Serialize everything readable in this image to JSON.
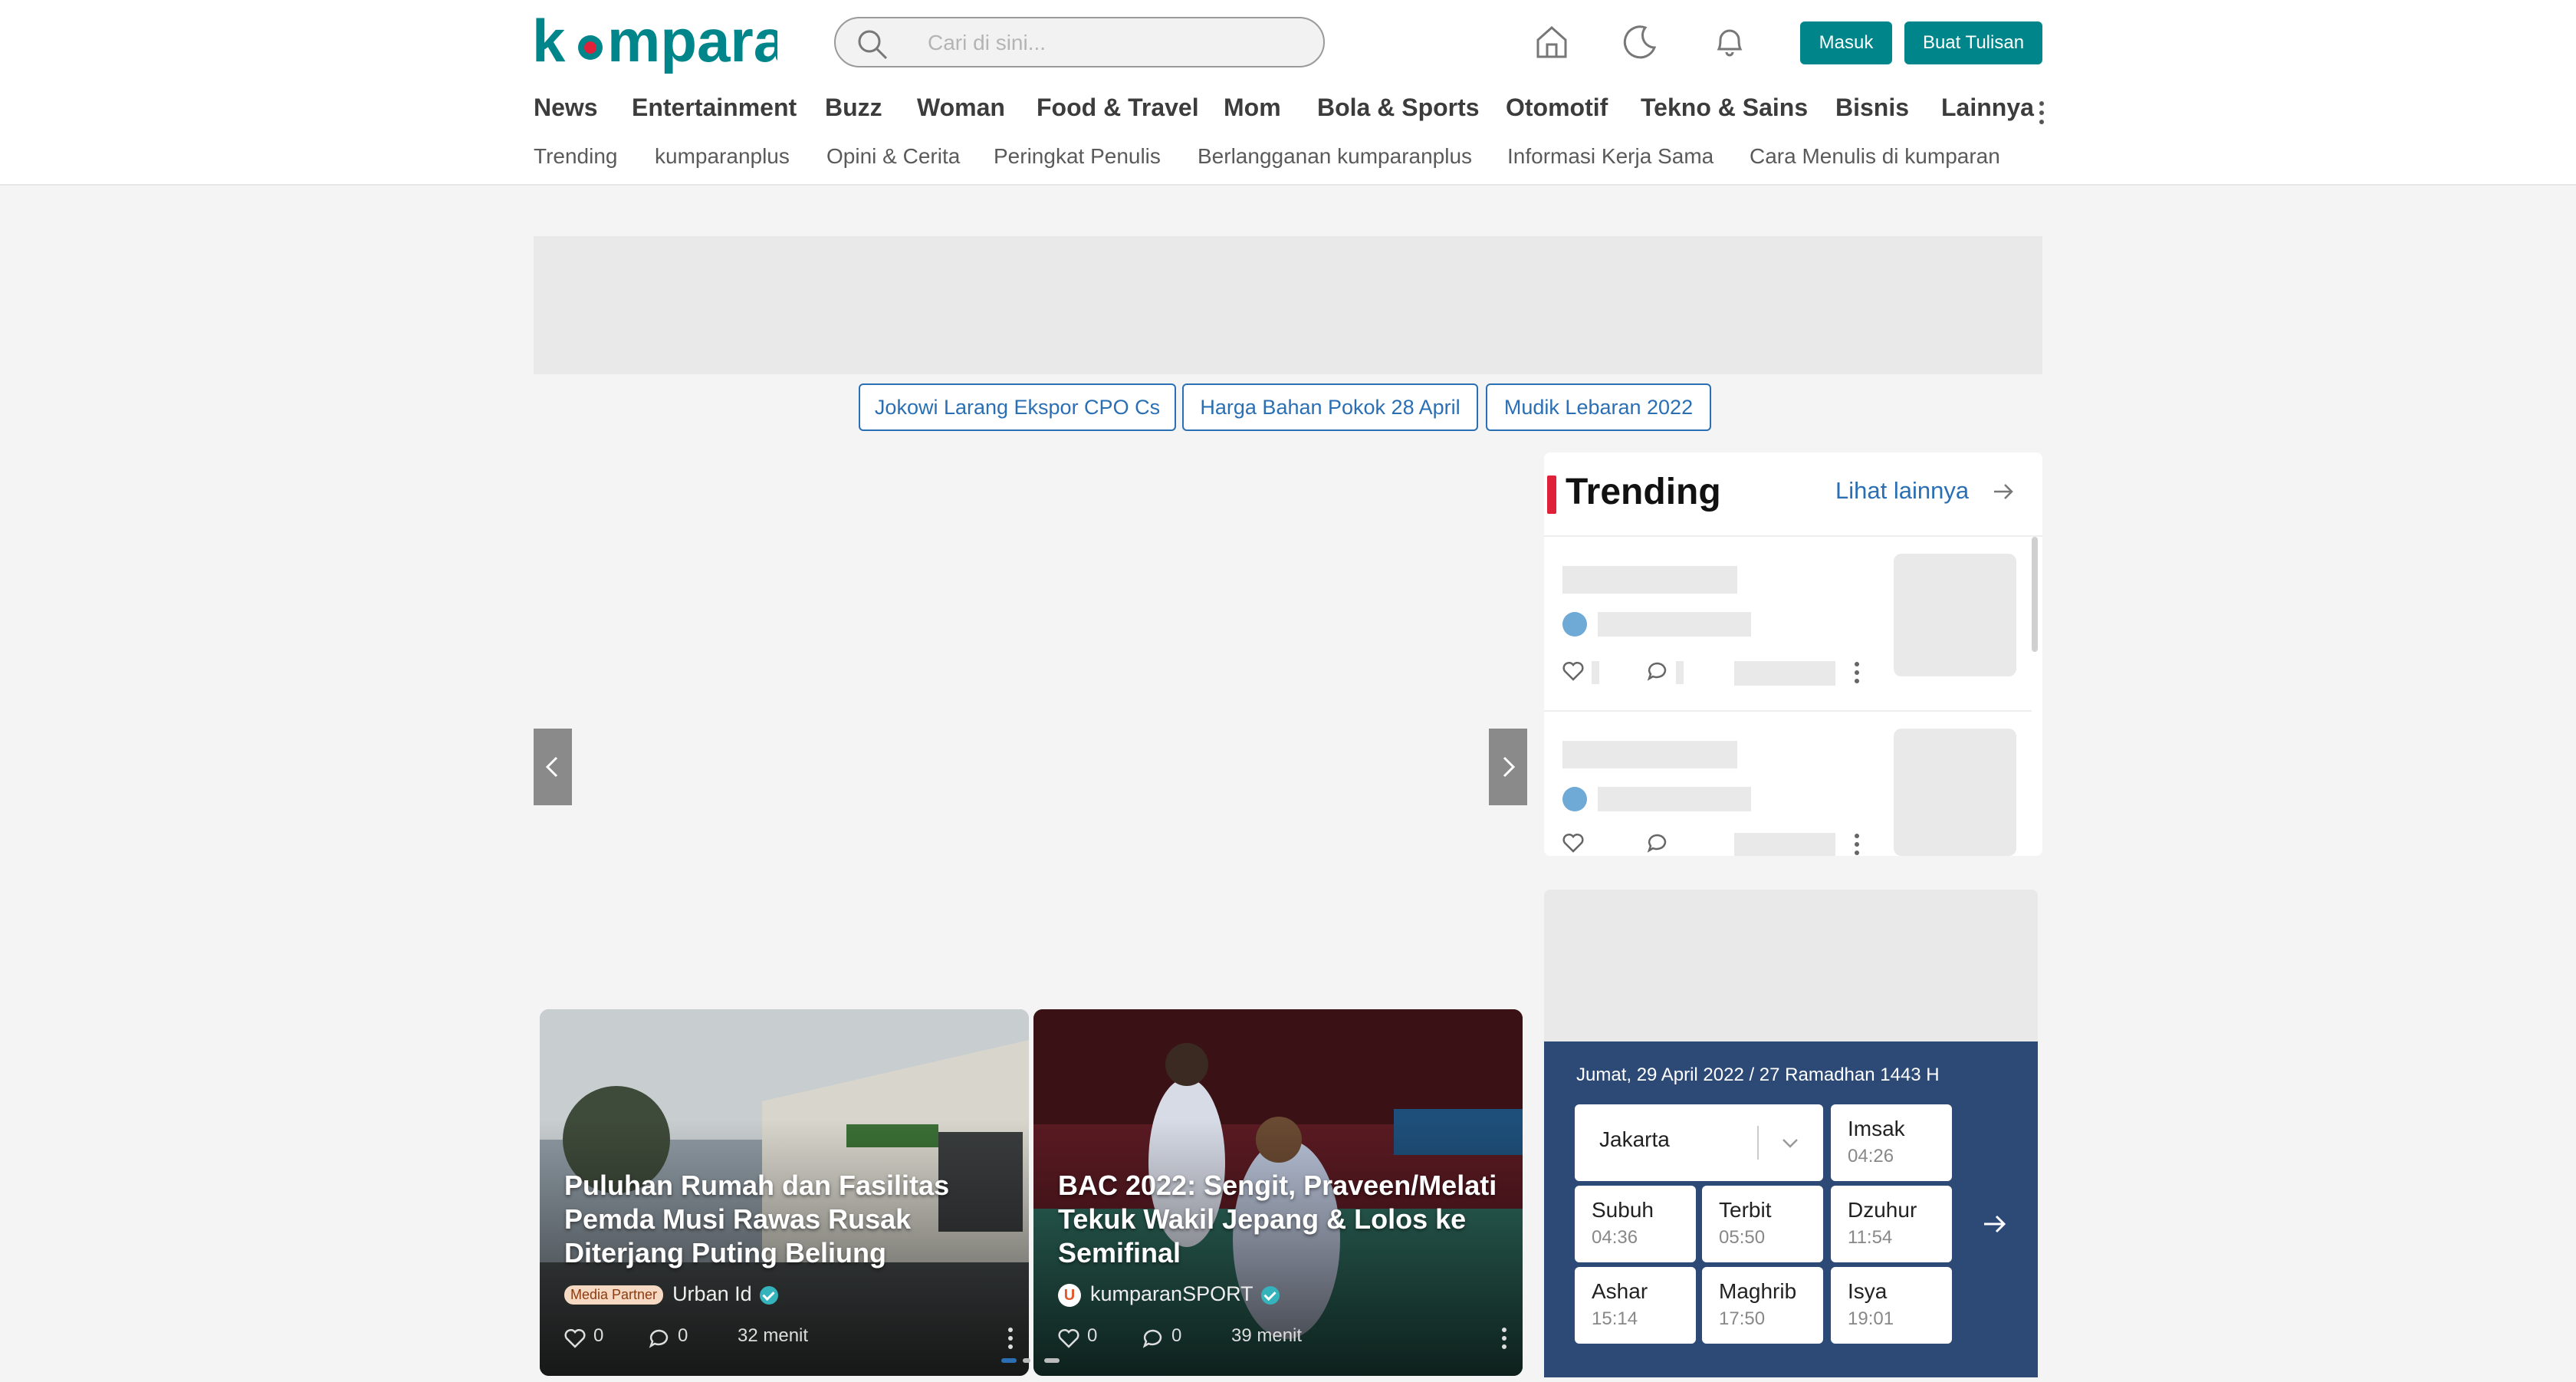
{
  "header": {
    "logo_text": "kumparan",
    "search_placeholder": "Cari di sini...",
    "login_label": "Masuk",
    "write_label": "Buat Tulisan"
  },
  "nav": {
    "items": [
      "News",
      "Entertainment",
      "Buzz",
      "Woman",
      "Food & Travel",
      "Mom",
      "Bola & Sports",
      "Otomotif",
      "Tekno & Sains",
      "Bisnis",
      "Lainnya"
    ]
  },
  "subnav": {
    "items": [
      "Trending",
      "kumparanplus",
      "Opini & Cerita",
      "Peringkat Penulis",
      "Berlangganan kumparanplus",
      "Informasi Kerja Sama",
      "Cara Menulis di kumparan"
    ]
  },
  "topics": [
    "Jokowi Larang Ekspor CPO Cs",
    "Harga Bahan Pokok 28 April",
    "Mudik Lebaran 2022"
  ],
  "cards": [
    {
      "title": "Puluhan Rumah dan Fasilitas Pemda Musi Rawas Rusak Diterjang Puting Beliung",
      "badge": "Media Partner",
      "source": "Urban Id",
      "likes": "0",
      "comments": "0",
      "time": "32 menit"
    },
    {
      "title": "BAC 2022: Sengit, Praveen/Melati Tekuk Wakil Jepang & Lolos ke Semifinal",
      "source": "kumparanSPORT",
      "likes": "0",
      "comments": "0",
      "time": "39 menit"
    }
  ],
  "trending": {
    "title": "Trending",
    "more_label": "Lihat lainnya"
  },
  "prayer": {
    "date": "Jumat, 29 April 2022 / 27 Ramadhan 1443 H",
    "city": "Jakarta",
    "times": [
      {
        "name": "Imsak",
        "time": "04:26"
      },
      {
        "name": "Subuh",
        "time": "04:36"
      },
      {
        "name": "Terbit",
        "time": "05:50"
      },
      {
        "name": "Dzuhur",
        "time": "11:54"
      },
      {
        "name": "Ashar",
        "time": "15:14"
      },
      {
        "name": "Maghrib",
        "time": "17:50"
      },
      {
        "name": "Isya",
        "time": "19:01"
      }
    ]
  },
  "colors": {
    "brand": "#00868a",
    "link": "#2a6fb4",
    "trending_accent": "#e0213a",
    "prayer_bg": "#2d4a77"
  }
}
